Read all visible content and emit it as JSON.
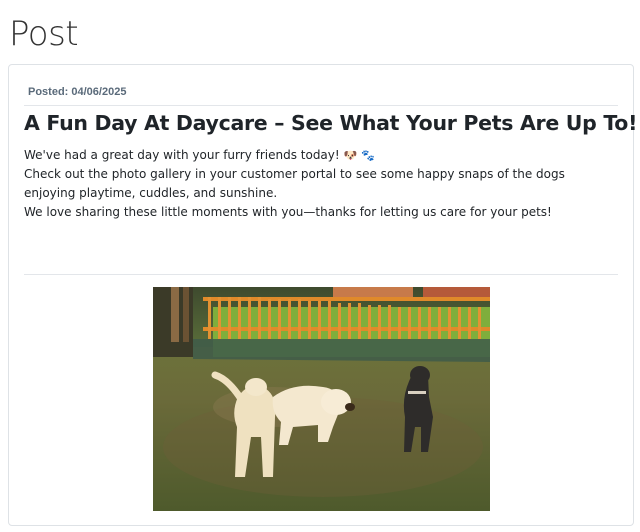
{
  "page": {
    "title": "Post"
  },
  "post": {
    "posted_label": "Posted: 04/06/2025",
    "heading": "A Fun Day At Daycare – See What Your Pets Are Up To!",
    "paragraphs": [
      "We've had a great day with your furry friends today!",
      "Check out the photo gallery in your customer portal to see some happy snaps of the dogs enjoying playtime, cuddles, and sunshine.",
      "We love sharing these little moments with you—thanks for letting us care for your pets!"
    ],
    "emojis": [
      "🐶",
      "🐾"
    ],
    "image_icon": "dogs-playing-photo"
  },
  "colors": {
    "card_border": "#dee2e6",
    "muted": "#5a6a7a",
    "heading": "#1f2429"
  }
}
